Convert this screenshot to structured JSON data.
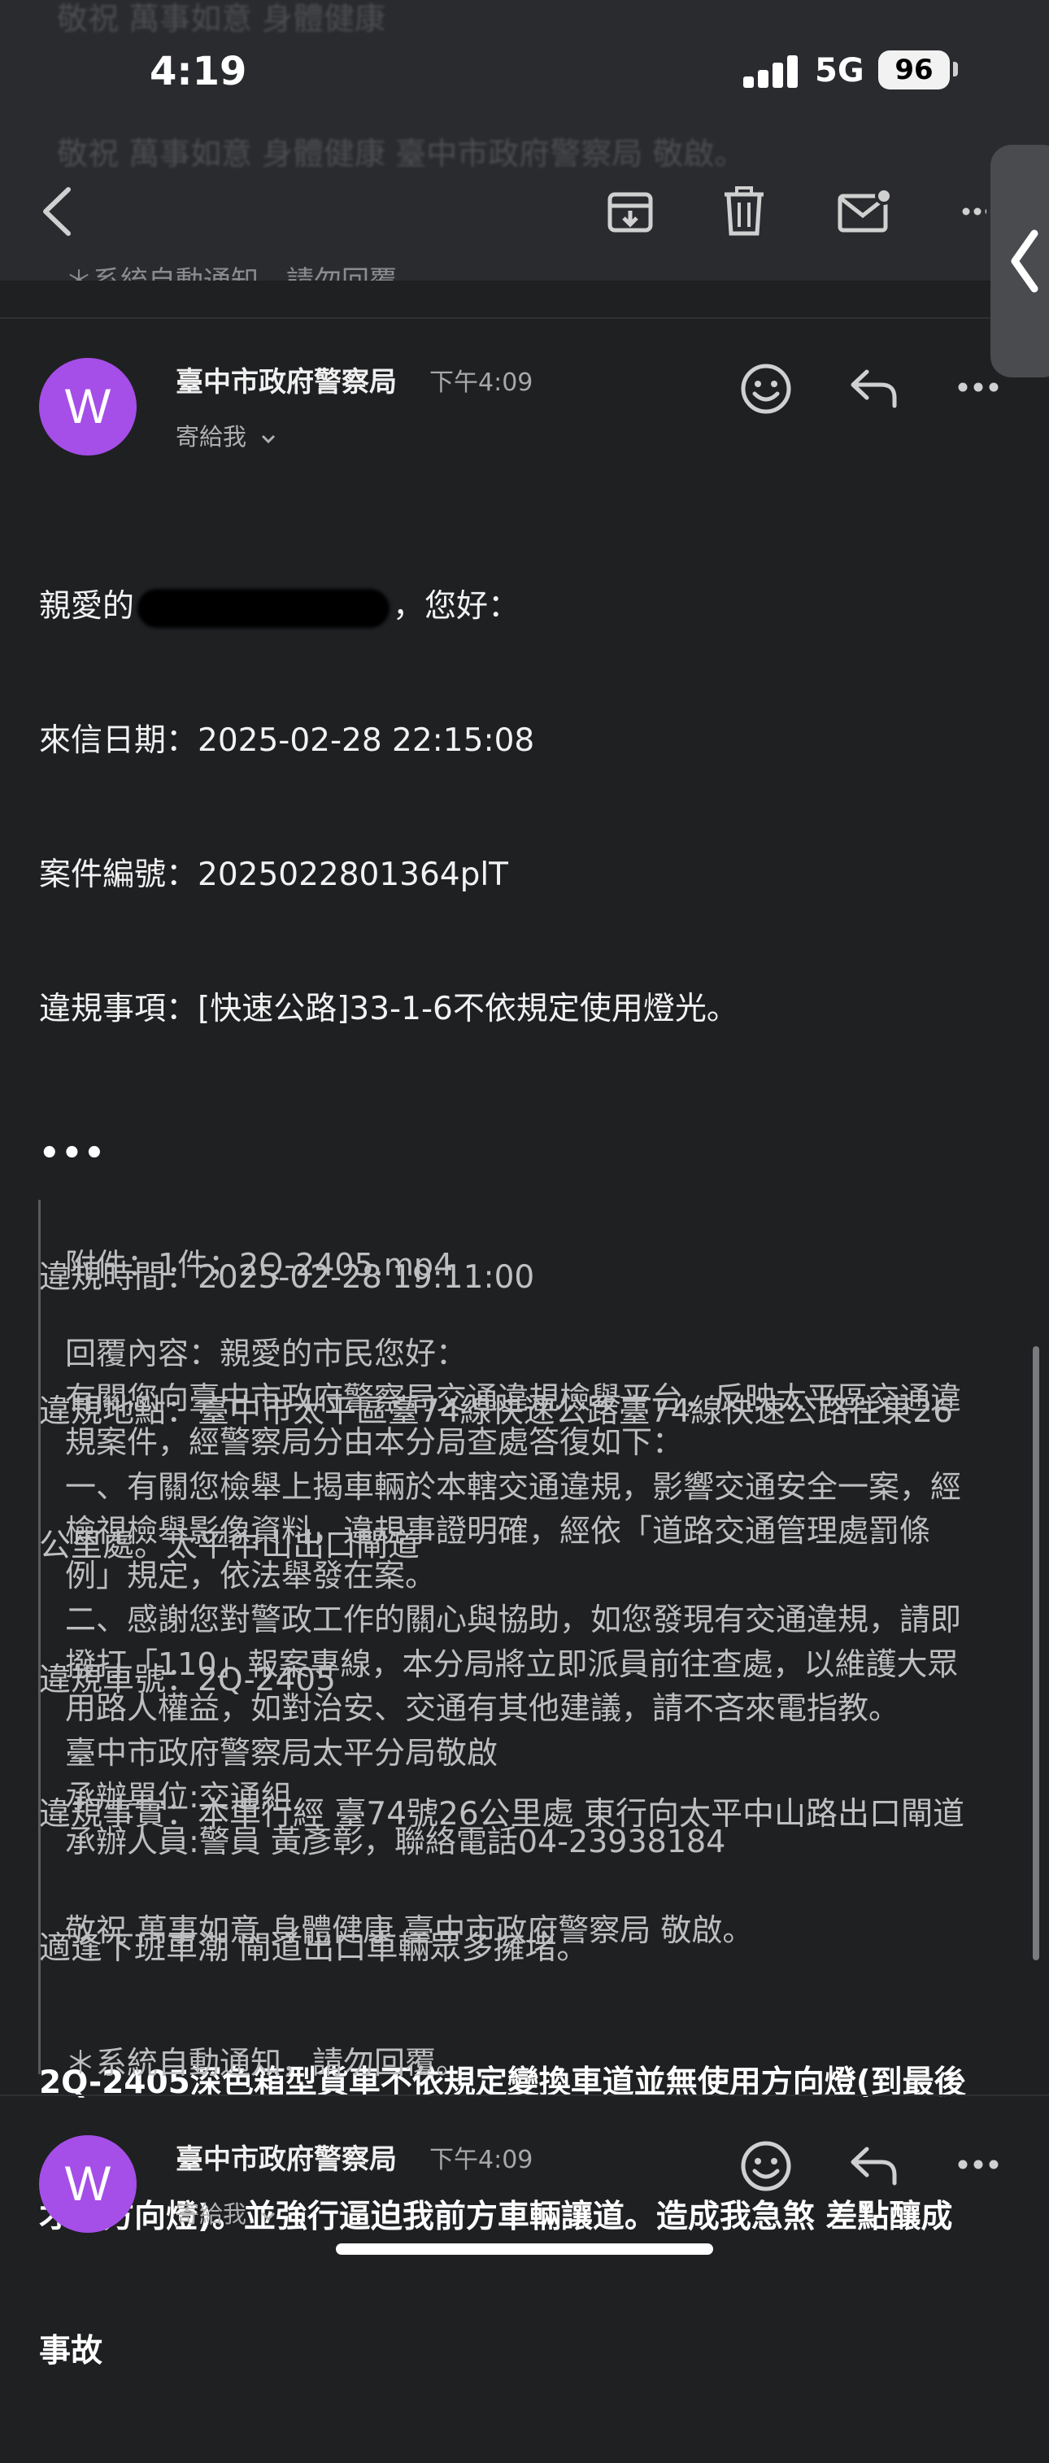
{
  "status_bar": {
    "time": "4:19",
    "network": "5G",
    "battery": "96"
  },
  "message1": {
    "auto_notice": "＊系統自動通知，請勿回覆。"
  },
  "message2": {
    "sender": "臺中市政府警察局",
    "time": "下午4:09",
    "to": "寄給我",
    "greeting_prefix": "親愛的",
    "greeting_suffix": "，您好：",
    "lines": [
      "來信日期：2025-02-28 22:15:08",
      "案件編號：2025022801364plT",
      "違規事項：[快速公路]33-1-6不依規定使用燈光。",
      "",
      "違規時間：2025-02-28 19:11:00",
      "違規地點：臺中市太平區臺74線快速公路臺74線快速公路往東26",
      "公里處。太平中山出口閘道",
      "違規車號：2Q-2405",
      "違規事實：本車行經 臺74號26公里處 東行向太平中山路出口閘道",
      "適逢下班車潮 閘道出口車輛眾多擁堵。"
    ],
    "highlight_lines": [
      "2Q-2405深色箱型貨車不依規定變換車道並無使用方向燈(到最後",
      "才打方向燈)。並強行逼迫我前方車輛讓道。造成我急煞 差點釀成",
      "事故"
    ],
    "more": "•••",
    "quoted": [
      "附件：1件；2Q-2405.mp4",
      "",
      "回覆內容：親愛的市民您好：",
      "有關您向臺中市政府警察局交通違規檢舉平台，反映太平區交通違",
      "規案件，經警察局分由本分局查處答復如下：",
      "一、有關您檢舉上揭車輛於本轄交通違規，影響交通安全一案，經",
      "檢視檢舉影像資料，違規事證明確，經依「道路交通管理處罰條",
      "例」規定，依法舉發在案。",
      "二、感謝您對警政工作的關心與協助，如您發現有交通違規，請即",
      "撥打「110」報案專線，本分局將立即派員前往查處，以維護大眾",
      "用路人權益，如對治安、交通有其他建議，請不吝來電指教。",
      "臺中市政府警察局太平分局敬啟",
      "承辦單位:交通組",
      "承辦人員:警員 黃彥彰，聯絡電話04-23938184",
      "",
      "敬祝 萬事如意 身體健康 臺中市政府警察局 敬啟。",
      "",
      "",
      "＊系統自動通知，請勿回覆。"
    ]
  },
  "message3": {
    "sender": "臺中市政府警察局",
    "time": "下午4:09",
    "to": "寄給我"
  },
  "avatar_letter": "W",
  "colors": {
    "avatar": "#a54ee8",
    "background": "#1f2022",
    "topbar": "#2a2b2e"
  }
}
